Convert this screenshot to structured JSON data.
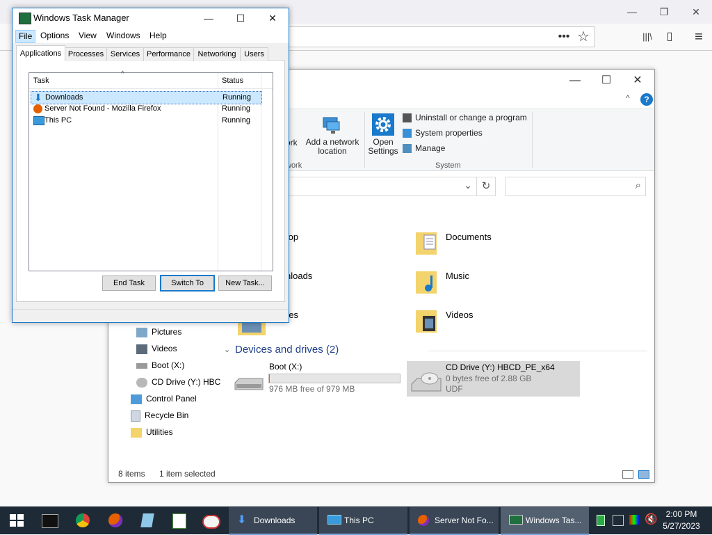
{
  "firefox": {
    "toolbar_icons": [
      "more-icon",
      "bookmark-star-icon",
      "library-icon",
      "sidebar-icon",
      "menu-icon"
    ],
    "more_glyph": "•••",
    "star_glyph": "☆",
    "library_glyph": "|||\\",
    "sidebar_glyph": "▯",
    "menu_glyph": "≡"
  },
  "explorer": {
    "window_controls": {
      "minimize": "—",
      "maximize": "☐",
      "close": "✕"
    },
    "ribbon": {
      "add_network_location_line1": "Add a network",
      "add_network_location_line2": "location",
      "network_partial": "ork",
      "network_group_partial": "work",
      "open_settings_line1": "Open",
      "open_settings_line2": "Settings",
      "uninstall": "Uninstall or change a program",
      "system_properties": "System properties",
      "manage": "Manage",
      "system_group": "System",
      "help": "?",
      "collapse": "^"
    },
    "address": {
      "dropdown": "⌄",
      "refresh": "↻"
    },
    "search": {
      "placeholder": "",
      "icon": "⌕"
    },
    "nav": [
      {
        "label": "Pictures"
      },
      {
        "label": "Videos"
      },
      {
        "label": "Boot (X:)"
      },
      {
        "label": "CD Drive (Y:) HBC"
      },
      {
        "label": "Control Panel"
      },
      {
        "label": "Recycle Bin"
      },
      {
        "label": "Utilities"
      }
    ],
    "folders": [
      {
        "label": "top"
      },
      {
        "label": "Documents"
      },
      {
        "label": "nloads"
      },
      {
        "label": "Music"
      },
      {
        "label": "res"
      },
      {
        "label": "Videos"
      }
    ],
    "devices_header": "Devices and drives (2)",
    "drives": [
      {
        "name": "Boot (X:)",
        "free": "976 MB free of 979 MB",
        "used_fraction": 0.003
      },
      {
        "name": "CD Drive (Y:) HBCD_PE_x64",
        "free": "0 bytes free of 2.88 GB",
        "fs": "UDF"
      }
    ],
    "status": {
      "items": "8 items",
      "selected": "1 item selected"
    }
  },
  "taskmgr": {
    "title": "Windows Task Manager",
    "window_controls": {
      "minimize": "—",
      "maximize": "☐",
      "close": "✕"
    },
    "menu": [
      "File",
      "Options",
      "View",
      "Windows",
      "Help"
    ],
    "tabs": [
      "Applications",
      "Processes",
      "Services",
      "Performance",
      "Networking",
      "Users"
    ],
    "columns": {
      "task": "Task",
      "status": "Status"
    },
    "rows": [
      {
        "task": "Downloads",
        "status": "Running"
      },
      {
        "task": "Server Not Found - Mozilla Firefox",
        "status": "Running"
      },
      {
        "task": "This PC",
        "status": "Running"
      }
    ],
    "buttons": {
      "end_task": "End Task",
      "switch_to": "Switch To",
      "new_task": "New Task..."
    }
  },
  "taskbar": {
    "tasks": [
      {
        "label": "Downloads"
      },
      {
        "label": "This PC"
      },
      {
        "label": "Server Not Fo..."
      },
      {
        "label": "Windows Tas..."
      }
    ],
    "clock_time": "2:00 PM",
    "clock_date": "5/27/2023"
  },
  "colors": {
    "accent": "#1979ca",
    "taskbar": "#1f2a37",
    "selection": "#cce8ff"
  }
}
